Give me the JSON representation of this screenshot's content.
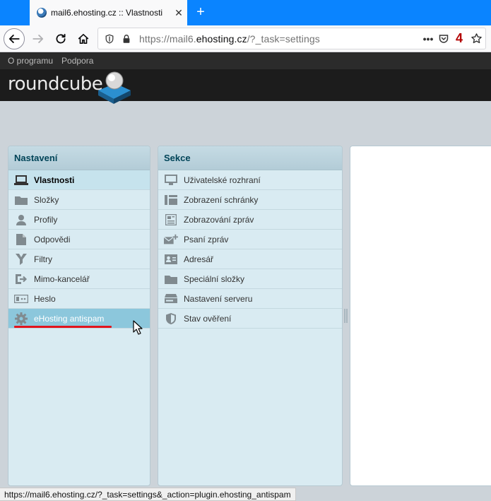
{
  "browser": {
    "tab_title": "mail6.ehosting.cz :: Vlastnosti",
    "close_glyph": "✕",
    "newtab_glyph": "+",
    "url_prefix": "https://mail6.",
    "url_host": "ehosting.cz",
    "url_suffix": "/?_task=settings",
    "more_glyph": "•••",
    "badge_count": "4",
    "status_url": "https://mail6.ehosting.cz/?_task=settings&_action=plugin.ehosting_antispam"
  },
  "topnav": {
    "about": "O programu",
    "support": "Podpora"
  },
  "logo": {
    "text": "roundcube"
  },
  "settings_panel": {
    "title": "Nastavení",
    "items": [
      {
        "label": "Vlastnosti",
        "icon": "laptop-icon"
      },
      {
        "label": "Složky",
        "icon": "folder-icon"
      },
      {
        "label": "Profily",
        "icon": "user-icon"
      },
      {
        "label": "Odpovědi",
        "icon": "document-icon"
      },
      {
        "label": "Filtry",
        "icon": "filter-icon"
      },
      {
        "label": "Mimo-kancelář",
        "icon": "exit-icon"
      },
      {
        "label": "Heslo",
        "icon": "password-icon"
      },
      {
        "label": "eHosting antispam",
        "icon": "gear-icon"
      }
    ]
  },
  "sections_panel": {
    "title": "Sekce",
    "items": [
      {
        "label": "Uživatelské rozhraní",
        "icon": "monitor-icon"
      },
      {
        "label": "Zobrazení schránky",
        "icon": "mailbox-layout-icon"
      },
      {
        "label": "Zobrazování zpráv",
        "icon": "message-view-icon"
      },
      {
        "label": "Psaní zpráv",
        "icon": "compose-icon"
      },
      {
        "label": "Adresář",
        "icon": "addressbook-icon"
      },
      {
        "label": "Speciální složky",
        "icon": "folder-icon"
      },
      {
        "label": "Nastavení serveru",
        "icon": "server-icon"
      },
      {
        "label": "Stav ověření",
        "icon": "shield-icon"
      }
    ]
  },
  "colors": {
    "accent": "#0a84ff",
    "selected_row": "#c6e3ed",
    "hover_row": "#8cc7dc",
    "underline": "#e2141d"
  }
}
